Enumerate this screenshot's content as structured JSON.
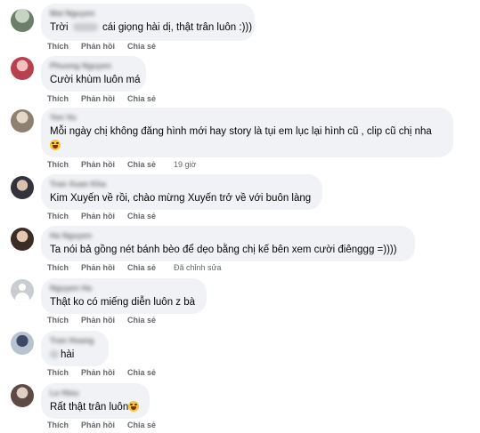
{
  "labels": {
    "like": "Thích",
    "reply": "Phản hồi",
    "share": "Chia sẻ"
  },
  "comments": [
    {
      "name": "Mai Nguyen",
      "text_before": "Trời",
      "text_after": "cái giọng hài dị, thật trân luôn :)))",
      "meta": ""
    },
    {
      "name": "Phuong Nguyen",
      "text": "Cười khùm luôn má",
      "meta": ""
    },
    {
      "name": "Yen Vu",
      "text": "Mỗi ngày chị không đăng hình mới hay story là tụi em lục lại hình cũ , clip cũ chị nha",
      "emoji": "laughing-face-icon",
      "meta": "19 giờ"
    },
    {
      "name": "Tran Xuan Kha",
      "text": "Kim Xuyến về rồi, chào mừng Xuyến trở về với buôn làng",
      "meta": ""
    },
    {
      "name": "Ha Nguyen",
      "text": "Ta nói bả gồng nét bánh bèo để dẹo bằng chị kế bên xem cười điênggg =))))",
      "meta": "Đã chỉnh sửa"
    },
    {
      "name": "Nguyen Ha",
      "text": "Thật ko có miếng diễn luôn z bà",
      "meta": ""
    },
    {
      "name": "Tran Hoang",
      "text": "hài",
      "meta": ""
    },
    {
      "name": "Le Hieu",
      "text": "Rất thật trân luôn",
      "emoji": "laughing-face-icon",
      "meta": ""
    }
  ]
}
